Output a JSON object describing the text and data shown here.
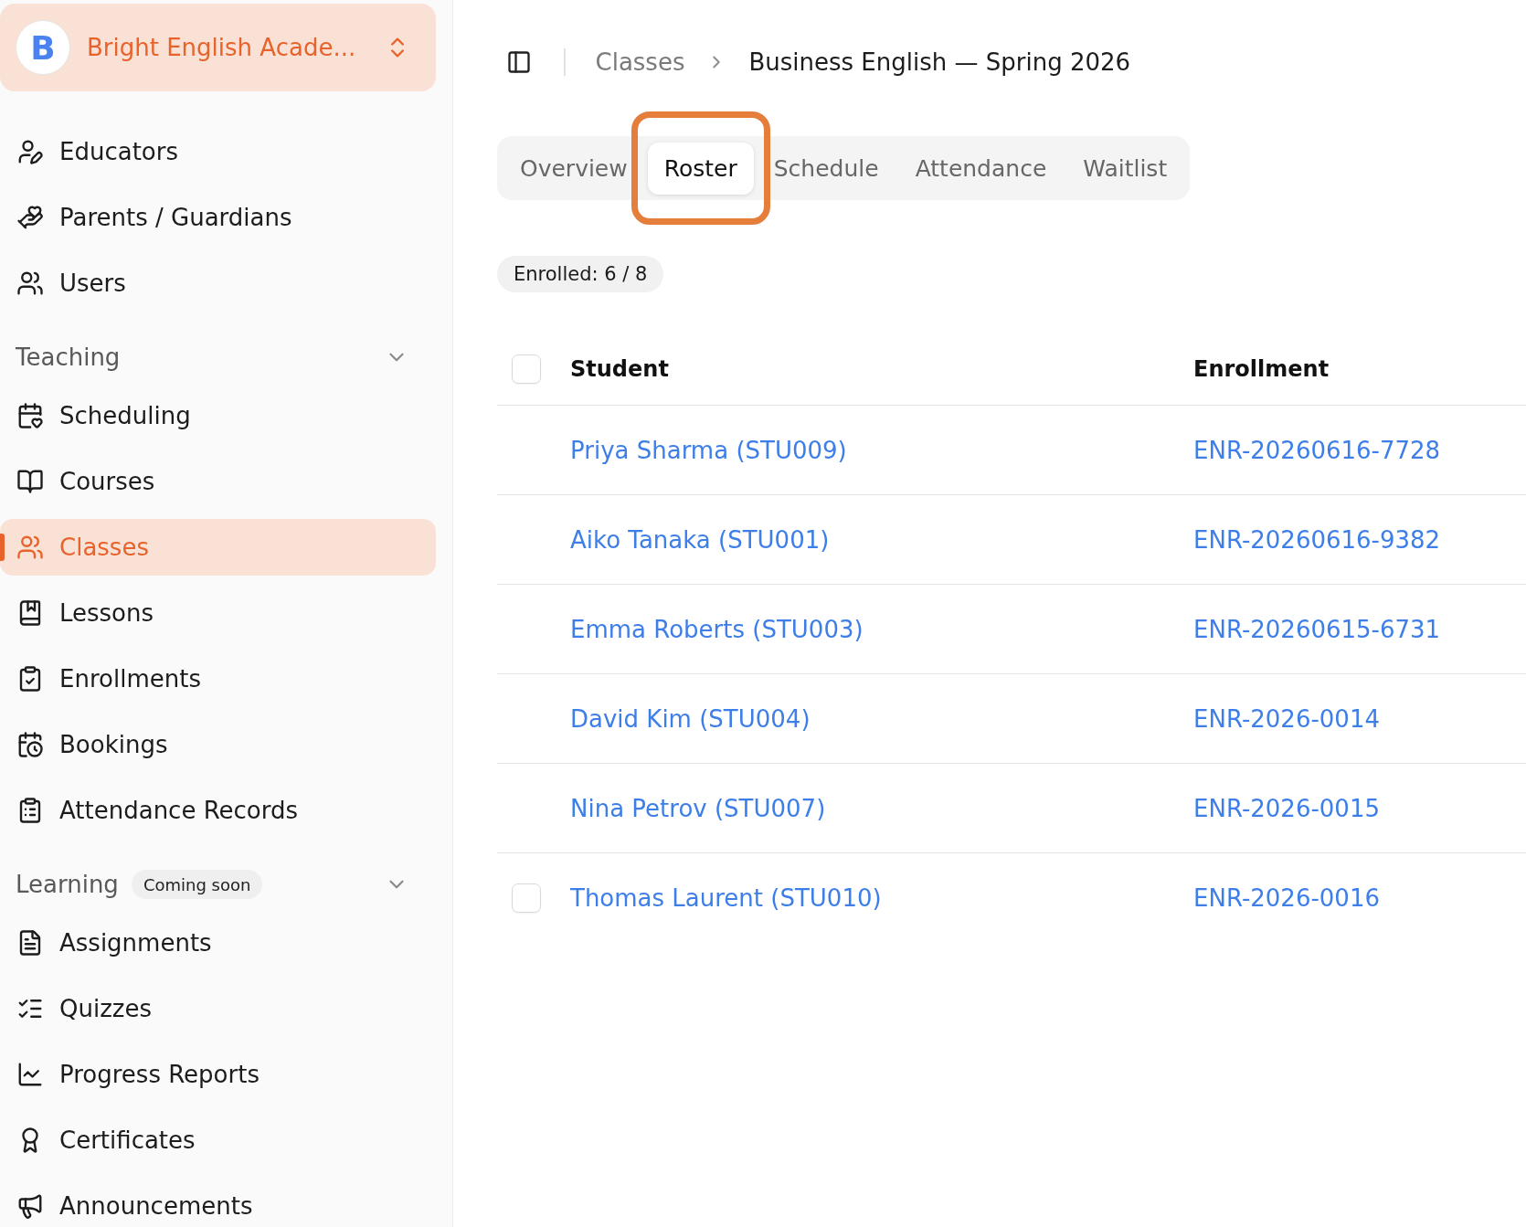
{
  "org_switcher": {
    "logo_letter": "B",
    "name": "Bright English Acade..."
  },
  "sidebar": {
    "sections": [
      {
        "items": [
          {
            "label": "Educators",
            "selected": false
          },
          {
            "label": "Parents / Guardians",
            "selected": false
          },
          {
            "label": "Users",
            "selected": false
          }
        ]
      },
      {
        "title": "Teaching",
        "expanded": true,
        "items": [
          {
            "label": "Scheduling",
            "selected": false
          },
          {
            "label": "Courses",
            "selected": false
          },
          {
            "label": "Classes",
            "selected": true
          },
          {
            "label": "Lessons",
            "selected": false
          },
          {
            "label": "Enrollments",
            "selected": false
          },
          {
            "label": "Bookings",
            "selected": false
          },
          {
            "label": "Attendance Records",
            "selected": false
          }
        ]
      },
      {
        "title": "Learning",
        "badge": "Coming soon",
        "expanded": true,
        "items": [
          {
            "label": "Assignments",
            "selected": false
          },
          {
            "label": "Quizzes",
            "selected": false
          },
          {
            "label": "Progress Reports",
            "selected": false
          },
          {
            "label": "Certificates",
            "selected": false
          },
          {
            "label": "Announcements",
            "selected": false
          }
        ]
      }
    ]
  },
  "breadcrumb": [
    {
      "label": "Classes",
      "current": false
    },
    {
      "label": "Business English — Spring 2026",
      "current": true
    }
  ],
  "tabs": [
    {
      "label": "Overview",
      "selected": false,
      "highlighted": false
    },
    {
      "label": "Roster",
      "selected": true,
      "highlighted": true
    },
    {
      "label": "Schedule",
      "selected": false,
      "highlighted": false
    },
    {
      "label": "Attendance",
      "selected": false,
      "highlighted": false
    },
    {
      "label": "Waitlist",
      "selected": false,
      "highlighted": false
    }
  ],
  "enrolled_badge": "Enrolled: 6 / 8",
  "table": {
    "select_all": {
      "checked": false
    },
    "columns": [
      "Student",
      "Enrollment"
    ],
    "rows": [
      {
        "student": "Priya Sharma (STU009)",
        "enrollment": "ENR-20260616-7728"
      },
      {
        "student": "Aiko Tanaka (STU001)",
        "enrollment": "ENR-20260616-9382"
      },
      {
        "student": "Emma Roberts (STU003)",
        "enrollment": "ENR-20260615-6731"
      },
      {
        "student": "David Kim (STU004)",
        "enrollment": "ENR-2026-0014"
      },
      {
        "student": "Nina Petrov (STU007)",
        "enrollment": "ENR-2026-0015"
      },
      {
        "student": "Thomas Laurent (STU010)",
        "enrollment": "ENR-2026-0016",
        "checkbox": {
          "checked": false
        }
      }
    ]
  }
}
